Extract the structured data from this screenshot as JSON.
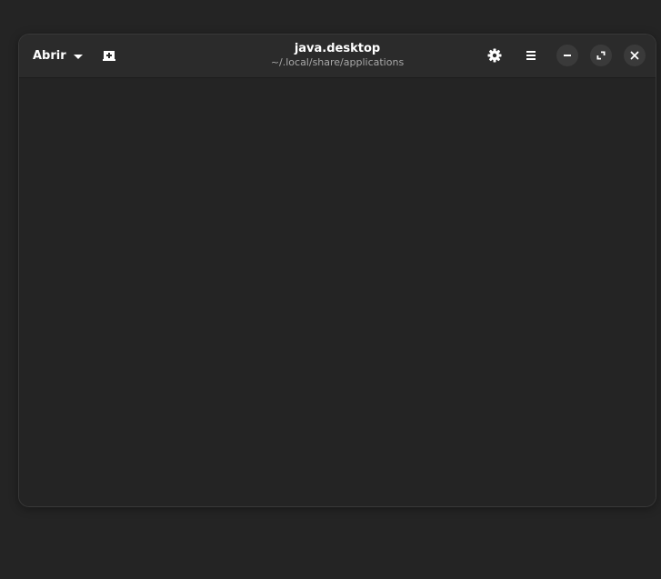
{
  "header": {
    "open_label": "Abrir",
    "title": "java.desktop",
    "subtitle": "~/.local/share/applications"
  },
  "icons": {
    "new_tab": "new-tab-icon",
    "settings": "gear-icon",
    "menu": "hamburger-menu-icon",
    "minimize": "minimize-icon",
    "maximize": "maximize-icon",
    "close": "close-icon"
  },
  "colors": {
    "background": "#242424",
    "headerbar": "#2b2b2b",
    "window_button": "#3a3a3a",
    "text": "#ffffff",
    "subtitle": "#a8a8a8"
  },
  "editor": {
    "content": ""
  }
}
